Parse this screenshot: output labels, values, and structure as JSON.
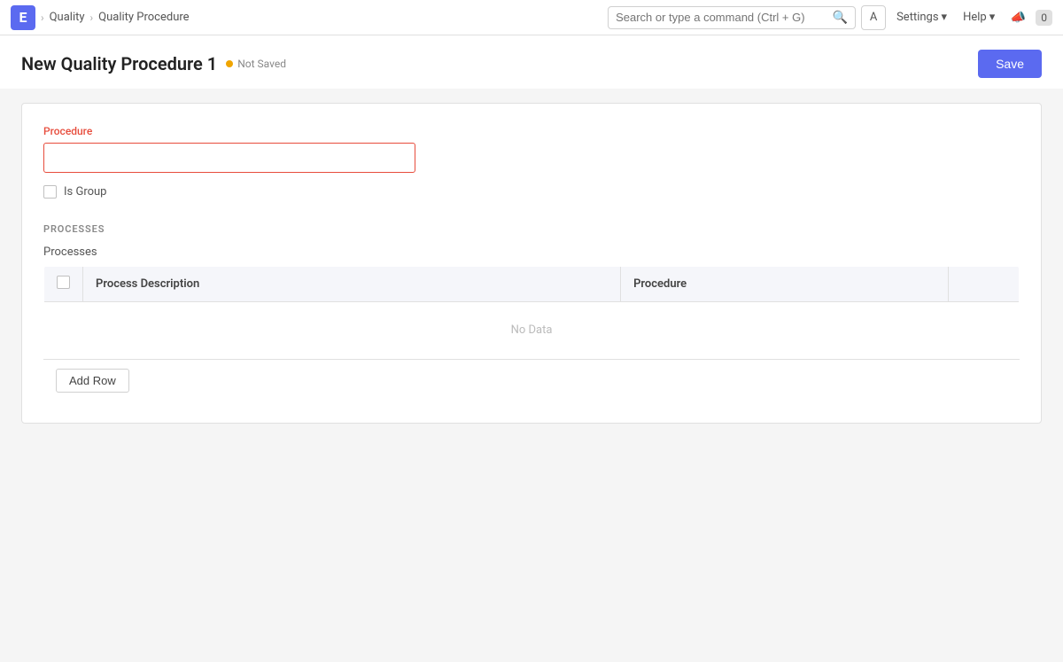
{
  "navbar": {
    "logo_letter": "E",
    "breadcrumb_home": "Quality",
    "breadcrumb_current": "Quality Procedure",
    "search_placeholder": "Search or type a command (Ctrl + G)",
    "avatar_letter": "A",
    "settings_label": "Settings",
    "help_label": "Help",
    "notifications_count": "0"
  },
  "page": {
    "title": "New Quality Procedure 1",
    "status": "Not Saved",
    "save_button": "Save"
  },
  "form": {
    "procedure_label": "Procedure",
    "procedure_value": "",
    "is_group_label": "Is Group"
  },
  "processes_section": {
    "section_title": "PROCESSES",
    "processes_label": "Processes",
    "table": {
      "columns": [
        {
          "key": "checkbox",
          "label": ""
        },
        {
          "key": "process_description",
          "label": "Process Description"
        },
        {
          "key": "procedure",
          "label": "Procedure"
        },
        {
          "key": "actions",
          "label": ""
        }
      ],
      "no_data_text": "No Data",
      "add_row_button": "Add Row"
    }
  }
}
